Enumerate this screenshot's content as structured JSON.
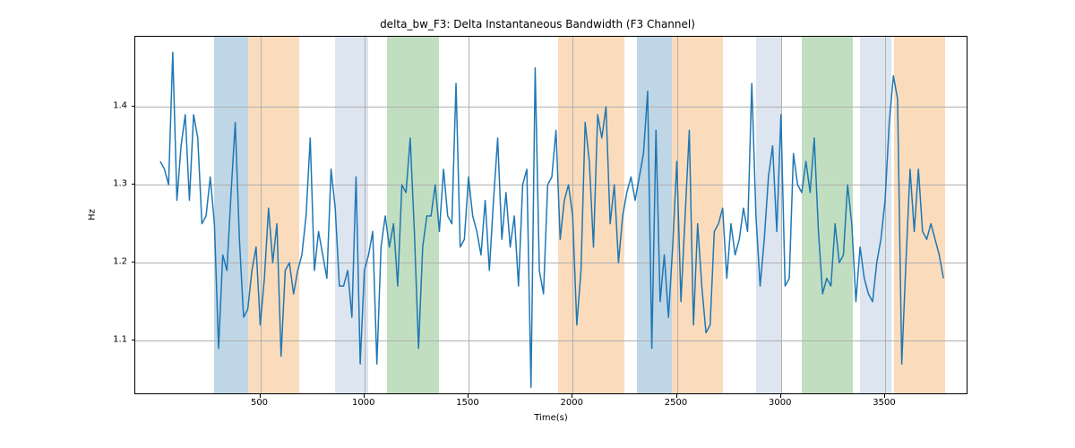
{
  "chart_data": {
    "type": "line",
    "title": "delta_bw_F3: Delta Instantaneous Bandwidth (F3 Channel)",
    "xlabel": "Time(s)",
    "ylabel": "Hz",
    "xlim": [
      -100,
      3900
    ],
    "ylim": [
      1.03,
      1.49
    ],
    "xticks": [
      500,
      1000,
      1500,
      2000,
      2500,
      3000,
      3500
    ],
    "yticks": [
      1.1,
      1.2,
      1.3,
      1.4
    ],
    "xtick_labels": [
      "500",
      "1000",
      "1500",
      "2000",
      "2500",
      "3000",
      "3500"
    ],
    "ytick_labels": [
      "1.1",
      "1.2",
      "1.3",
      "1.4"
    ],
    "bands": [
      {
        "x0": 280,
        "x1": 440,
        "color": "#bfd6e6"
      },
      {
        "x0": 440,
        "x1": 685,
        "color": "#fadcbc"
      },
      {
        "x0": 860,
        "x1": 1020,
        "color": "#dce5f0"
      },
      {
        "x0": 1110,
        "x1": 1360,
        "color": "#c1dfc0"
      },
      {
        "x0": 1930,
        "x1": 2250,
        "color": "#fadcbc"
      },
      {
        "x0": 2310,
        "x1": 2475,
        "color": "#bfd6e6"
      },
      {
        "x0": 2475,
        "x1": 2720,
        "color": "#fadcbc"
      },
      {
        "x0": 2880,
        "x1": 3000,
        "color": "#dce5f0"
      },
      {
        "x0": 3100,
        "x1": 3345,
        "color": "#c1dfc0"
      },
      {
        "x0": 3380,
        "x1": 3530,
        "color": "#dce5f0"
      },
      {
        "x0": 3545,
        "x1": 3790,
        "color": "#fadcbc"
      }
    ],
    "x": [
      20,
      40,
      60,
      80,
      100,
      120,
      140,
      160,
      180,
      200,
      220,
      240,
      260,
      280,
      300,
      320,
      340,
      360,
      380,
      400,
      420,
      440,
      460,
      480,
      500,
      520,
      540,
      560,
      580,
      600,
      620,
      640,
      660,
      680,
      700,
      720,
      740,
      760,
      780,
      800,
      820,
      840,
      860,
      880,
      900,
      920,
      940,
      960,
      980,
      1000,
      1020,
      1040,
      1060,
      1080,
      1100,
      1120,
      1140,
      1160,
      1180,
      1200,
      1220,
      1240,
      1260,
      1280,
      1300,
      1320,
      1340,
      1360,
      1380,
      1400,
      1420,
      1440,
      1460,
      1480,
      1500,
      1520,
      1540,
      1560,
      1580,
      1600,
      1620,
      1640,
      1660,
      1680,
      1700,
      1720,
      1740,
      1760,
      1780,
      1800,
      1820,
      1840,
      1860,
      1880,
      1900,
      1920,
      1940,
      1960,
      1980,
      2000,
      2020,
      2040,
      2060,
      2080,
      2100,
      2120,
      2140,
      2160,
      2180,
      2200,
      2220,
      2240,
      2260,
      2280,
      2300,
      2320,
      2340,
      2360,
      2380,
      2400,
      2420,
      2440,
      2460,
      2480,
      2500,
      2520,
      2540,
      2560,
      2580,
      2600,
      2620,
      2640,
      2660,
      2680,
      2700,
      2720,
      2740,
      2760,
      2780,
      2800,
      2820,
      2840,
      2860,
      2880,
      2900,
      2920,
      2940,
      2960,
      2980,
      3000,
      3020,
      3040,
      3060,
      3080,
      3100,
      3120,
      3140,
      3160,
      3180,
      3200,
      3220,
      3240,
      3260,
      3280,
      3300,
      3320,
      3340,
      3360,
      3380,
      3400,
      3420,
      3440,
      3460,
      3480,
      3500,
      3520,
      3540,
      3560,
      3580,
      3600,
      3620,
      3640,
      3660,
      3680,
      3700,
      3720,
      3740,
      3760,
      3780
    ],
    "values": [
      1.33,
      1.32,
      1.3,
      1.47,
      1.28,
      1.35,
      1.39,
      1.28,
      1.39,
      1.36,
      1.25,
      1.26,
      1.31,
      1.25,
      1.09,
      1.21,
      1.19,
      1.29,
      1.38,
      1.23,
      1.13,
      1.14,
      1.19,
      1.22,
      1.12,
      1.18,
      1.27,
      1.2,
      1.25,
      1.08,
      1.19,
      1.2,
      1.16,
      1.19,
      1.21,
      1.26,
      1.36,
      1.19,
      1.24,
      1.21,
      1.18,
      1.32,
      1.27,
      1.17,
      1.17,
      1.19,
      1.13,
      1.31,
      1.07,
      1.19,
      1.21,
      1.24,
      1.07,
      1.22,
      1.26,
      1.22,
      1.25,
      1.17,
      1.3,
      1.29,
      1.36,
      1.24,
      1.09,
      1.22,
      1.26,
      1.26,
      1.3,
      1.24,
      1.32,
      1.26,
      1.25,
      1.43,
      1.22,
      1.23,
      1.31,
      1.26,
      1.24,
      1.21,
      1.28,
      1.19,
      1.28,
      1.36,
      1.23,
      1.29,
      1.22,
      1.26,
      1.17,
      1.3,
      1.32,
      1.04,
      1.45,
      1.19,
      1.16,
      1.3,
      1.31,
      1.37,
      1.23,
      1.28,
      1.3,
      1.26,
      1.12,
      1.19,
      1.38,
      1.33,
      1.22,
      1.39,
      1.36,
      1.4,
      1.25,
      1.3,
      1.2,
      1.26,
      1.29,
      1.31,
      1.28,
      1.31,
      1.34,
      1.42,
      1.09,
      1.37,
      1.15,
      1.21,
      1.13,
      1.22,
      1.33,
      1.15,
      1.26,
      1.37,
      1.12,
      1.25,
      1.17,
      1.11,
      1.12,
      1.24,
      1.25,
      1.27,
      1.18,
      1.25,
      1.21,
      1.23,
      1.27,
      1.24,
      1.43,
      1.26,
      1.17,
      1.23,
      1.31,
      1.35,
      1.24,
      1.39,
      1.17,
      1.18,
      1.34,
      1.3,
      1.29,
      1.33,
      1.29,
      1.36,
      1.24,
      1.16,
      1.18,
      1.17,
      1.25,
      1.2,
      1.21,
      1.3,
      1.25,
      1.15,
      1.22,
      1.18,
      1.16,
      1.15,
      1.2,
      1.23,
      1.28,
      1.38,
      1.44,
      1.41,
      1.07,
      1.2,
      1.32,
      1.24,
      1.32,
      1.24,
      1.23,
      1.25,
      1.23,
      1.21,
      1.18,
      1.18
    ]
  }
}
